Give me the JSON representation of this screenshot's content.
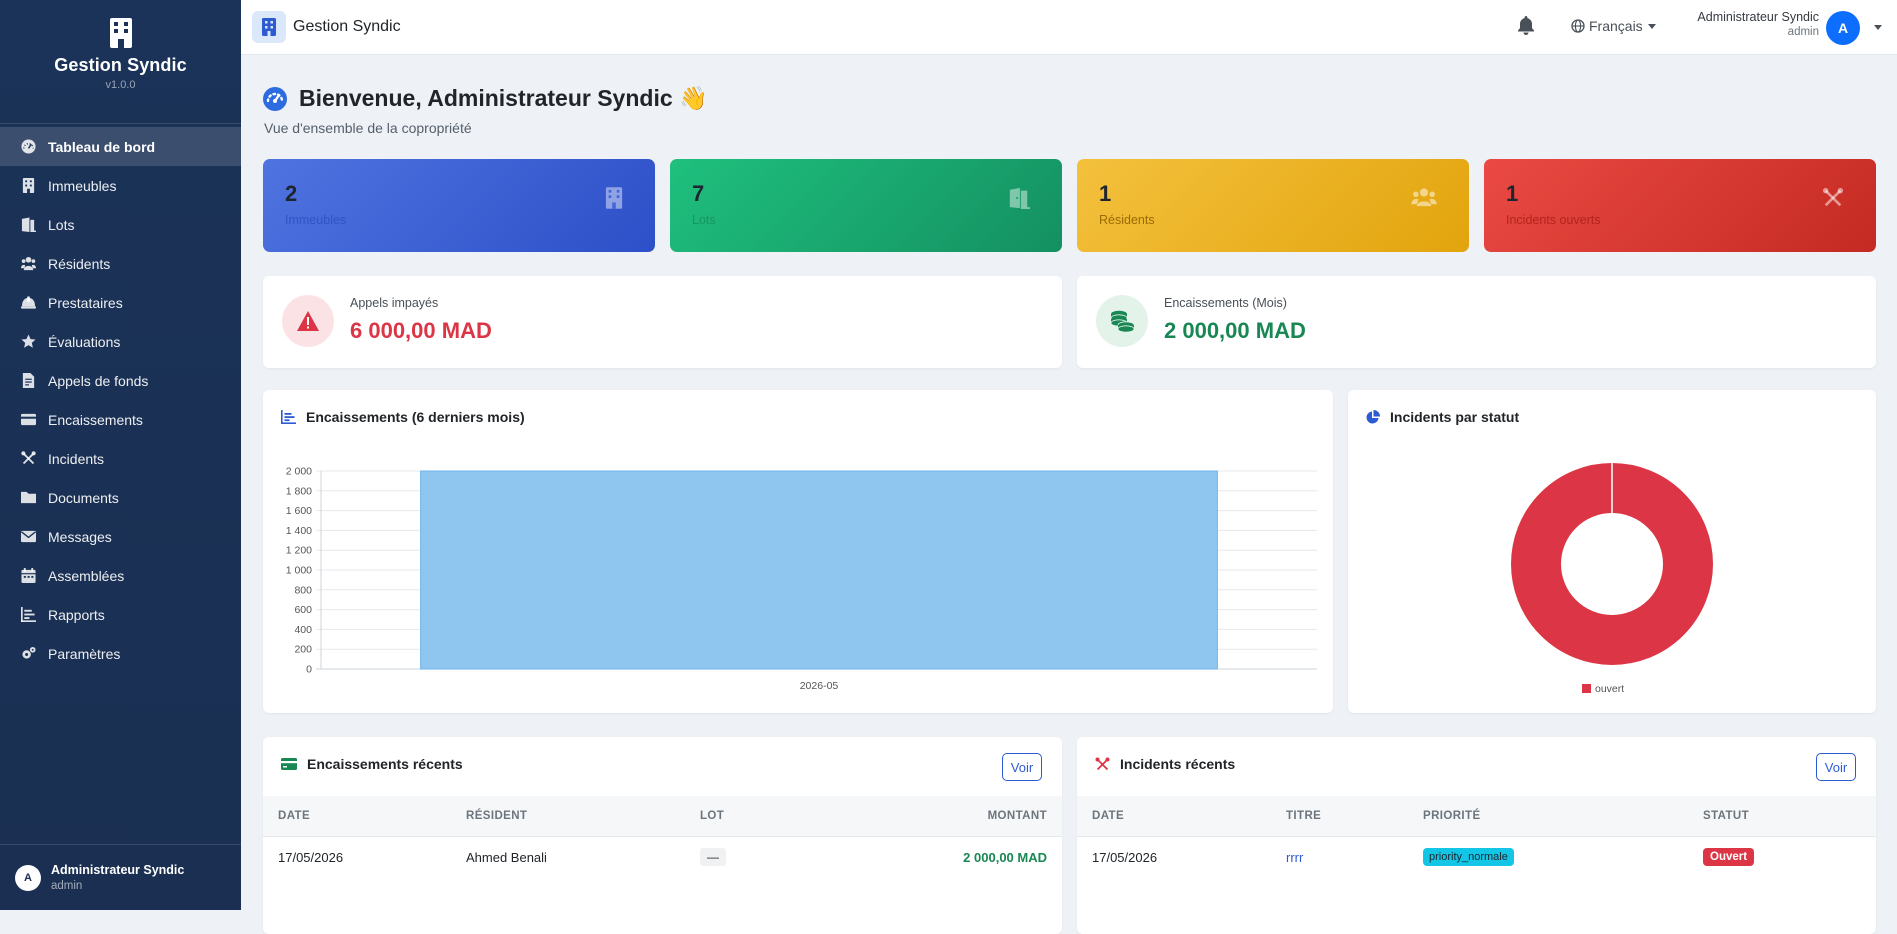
{
  "app": {
    "name": "Gestion Syndic",
    "version": "v1.0.0"
  },
  "sidebar": {
    "items": [
      {
        "label": "Tableau de bord",
        "icon": "gauge-icon",
        "active": true
      },
      {
        "label": "Immeubles",
        "icon": "building-icon"
      },
      {
        "label": "Lots",
        "icon": "door-icon"
      },
      {
        "label": "Résidents",
        "icon": "users-icon"
      },
      {
        "label": "Prestataires",
        "icon": "hard-hat-icon"
      },
      {
        "label": "Évaluations",
        "icon": "star-icon"
      },
      {
        "label": "Appels de fonds",
        "icon": "invoice-icon"
      },
      {
        "label": "Encaissements",
        "icon": "credit-card-icon"
      },
      {
        "label": "Incidents",
        "icon": "tools-icon"
      },
      {
        "label": "Documents",
        "icon": "folder-icon"
      },
      {
        "label": "Messages",
        "icon": "envelope-icon"
      },
      {
        "label": "Assemblées",
        "icon": "calendar-icon"
      },
      {
        "label": "Rapports",
        "icon": "chart-icon"
      },
      {
        "label": "Paramètres",
        "icon": "gears-icon"
      }
    ],
    "footer": {
      "avatar": "A",
      "name": "Administrateur Syndic",
      "role": "admin"
    }
  },
  "topbar": {
    "title": "Gestion Syndic",
    "language": "Français",
    "user_name": "Administrateur Syndic",
    "user_role": "admin",
    "avatar": "A"
  },
  "header": {
    "title": "Bienvenue, Administrateur Syndic 👋",
    "subtitle": "Vue d'ensemble de la copropriété"
  },
  "stats": [
    {
      "value": "2",
      "label": "Immeubles",
      "icon": "building-icon",
      "color": "#3b5fd6"
    },
    {
      "value": "7",
      "label": "Lots",
      "icon": "door-icon",
      "color": "#1aa870"
    },
    {
      "value": "1",
      "label": "Résidents",
      "icon": "users-icon",
      "color": "#ebb222"
    },
    {
      "value": "1",
      "label": "Incidents ouverts",
      "icon": "tools-icon",
      "color": "#d93a32"
    }
  ],
  "kpis": {
    "unpaid": {
      "label": "Appels impayés",
      "value": "6 000,00 MAD",
      "color": "#dc3545"
    },
    "collections": {
      "label": "Encaissements (Mois)",
      "value": "2 000,00 MAD",
      "color": "#198754"
    }
  },
  "charts": {
    "bar_title": "Encaissements (6 derniers mois)",
    "donut_title": "Incidents par statut"
  },
  "chart_data": [
    {
      "type": "bar",
      "title": "Encaissements (6 derniers mois)",
      "categories": [
        "2026-05"
      ],
      "values": [
        2000
      ],
      "ylim": [
        0,
        2000
      ],
      "yticks": [
        "0",
        "200",
        "400",
        "600",
        "800",
        "1 000",
        "1 200",
        "1 400",
        "1 600",
        "1 800",
        "2 000"
      ],
      "color": "#8ec6f0",
      "grid": true
    },
    {
      "type": "pie",
      "title": "Incidents par statut",
      "labels": [
        "ouvert"
      ],
      "values": [
        1
      ],
      "colors": [
        "#dc3545"
      ],
      "donut": true,
      "legend": "bottom"
    }
  ],
  "recent_payments": {
    "title": "Encaissements récents",
    "button": "Voir",
    "columns": [
      "DATE",
      "RÉSIDENT",
      "LOT",
      "MONTANT"
    ],
    "rows": [
      {
        "date": "17/05/2026",
        "resident": "Ahmed Benali",
        "lot": "—",
        "amount": "2 000,00 MAD"
      }
    ]
  },
  "recent_incidents": {
    "title": "Incidents récents",
    "button": "Voir",
    "columns": [
      "DATE",
      "TITRE",
      "PRIORITÉ",
      "STATUT"
    ],
    "rows": [
      {
        "date": "17/05/2026",
        "title": "rrrr",
        "priority": "priority_normale",
        "status": "Ouvert"
      }
    ]
  }
}
